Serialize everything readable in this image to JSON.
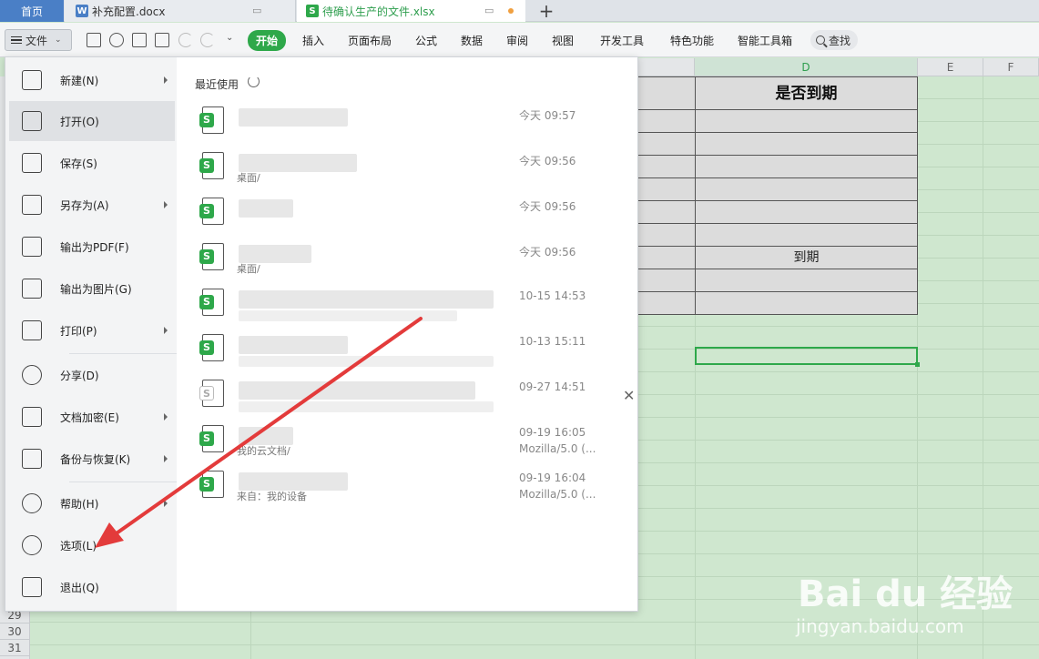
{
  "tabs": {
    "home": "首页",
    "doc": "补充配置.docx",
    "doc_icon": "W",
    "xls": "待确认生产的文件.xlsx",
    "xls_icon": "S"
  },
  "toolbar": {
    "file_label": "文件",
    "ribbon": [
      "开始",
      "插入",
      "页面布局",
      "公式",
      "数据",
      "审阅",
      "视图",
      "开发工具",
      "特色功能",
      "智能工具箱"
    ],
    "search_label": "查找"
  },
  "sheet": {
    "columns": [
      "D",
      "E",
      "F"
    ],
    "rows_visible": [
      "29",
      "30",
      "31"
    ],
    "header_cell": "是否到期",
    "cells": [
      "",
      "",
      "",
      "",
      "",
      "",
      "到期",
      "",
      ""
    ]
  },
  "file_menu": {
    "items": [
      {
        "label": "新建(N)",
        "icon": "new-file-icon",
        "submenu": true
      },
      {
        "label": "打开(O)",
        "icon": "folder-icon",
        "submenu": false,
        "active": true
      },
      {
        "label": "保存(S)",
        "icon": "save-icon",
        "submenu": false
      },
      {
        "label": "另存为(A)",
        "icon": "save-as-icon",
        "submenu": true
      },
      {
        "label": "输出为PDF(F)",
        "icon": "pdf-icon",
        "submenu": false
      },
      {
        "label": "输出为图片(G)",
        "icon": "image-icon",
        "submenu": false
      },
      {
        "label": "打印(P)",
        "icon": "printer-icon",
        "submenu": true
      },
      {
        "label": "分享(D)",
        "icon": "share-icon",
        "submenu": false
      },
      {
        "label": "文档加密(E)",
        "icon": "lock-doc-icon",
        "submenu": true
      },
      {
        "label": "备份与恢复(K)",
        "icon": "backup-icon",
        "submenu": true
      },
      {
        "label": "帮助(H)",
        "icon": "help-icon",
        "submenu": true
      },
      {
        "label": "选项(L)",
        "icon": "gear-icon",
        "submenu": false
      },
      {
        "label": "退出(Q)",
        "icon": "exit-icon",
        "submenu": false
      }
    ],
    "recent_title": "最近使用",
    "recent": [
      {
        "time": "今天 09:57",
        "meta": "",
        "sub": "",
        "icon": "S"
      },
      {
        "time": "今天 09:56",
        "meta": "",
        "sub": "桌面/",
        "icon": "S"
      },
      {
        "time": "今天 09:56",
        "meta": "",
        "sub": "",
        "icon": "S"
      },
      {
        "time": "今天 09:56",
        "meta": "",
        "sub": "桌面/",
        "icon": "S"
      },
      {
        "time": "10-15 14:53",
        "meta": "",
        "sub": "",
        "icon": "S"
      },
      {
        "time": "10-13 15:11",
        "meta": "",
        "sub": "",
        "icon": "S"
      },
      {
        "time": "09-27 14:51",
        "meta": "",
        "sub": "",
        "icon": "S"
      },
      {
        "time": "09-19 16:05",
        "meta": "Mozilla/5.0 (...",
        "sub": "我的云文档/",
        "icon": "S"
      },
      {
        "time": "09-19 16:04",
        "meta": "Mozilla/5.0 (...",
        "sub": "来自：我的设备",
        "icon": "S"
      }
    ]
  },
  "watermark": {
    "main": "Bai du 经验",
    "sub": "jingyan.baidu.com"
  },
  "colors": {
    "accent": "#2ea84a",
    "home_tab": "#4a7fc6"
  }
}
